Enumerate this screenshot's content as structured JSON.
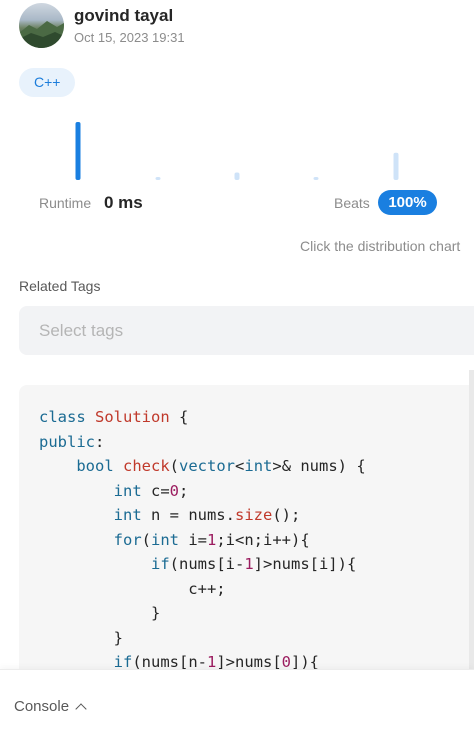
{
  "author": {
    "name": "govind tayal",
    "date": "Oct 15, 2023 19:31"
  },
  "language_tag": "C++",
  "runtime": {
    "label": "Runtime",
    "value": "0 ms",
    "beats_label": "Beats",
    "beats_value": "100%",
    "hint": "Click the distribution chart"
  },
  "distribution_chart": {
    "type": "bar",
    "bar_levels": [
      1.0,
      0.05,
      0.13,
      0.05,
      0.47
    ],
    "highlight_index": 0,
    "highlight_color": "#1a7fe0",
    "other_color": "#cfe3f8"
  },
  "related_tags": {
    "label": "Related Tags",
    "placeholder": "Select tags"
  },
  "code_lines": [
    "class Solution {",
    "public:",
    "    bool check(vector<int>& nums) {",
    "        int c=0;",
    "        int n = nums.size();",
    "        for(int i=1;i<n;i++){",
    "            if(nums[i-1]>nums[i]){",
    "                c++;",
    "            }",
    "        }",
    "        if(nums[n-1]>nums[0]){"
  ],
  "console": {
    "label": "Console",
    "icon": "chevron-up-icon"
  }
}
